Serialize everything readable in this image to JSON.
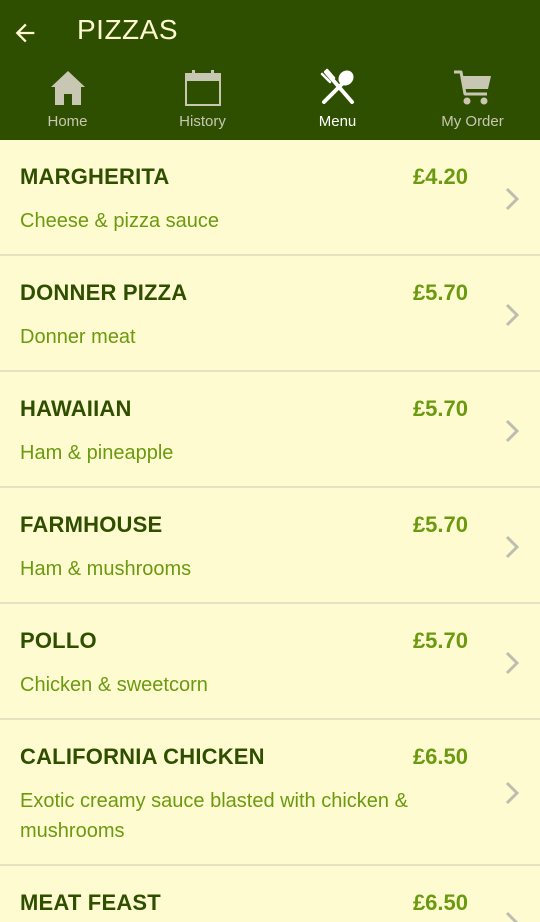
{
  "header": {
    "title": "PIZZAS",
    "back_icon": "arrow-left-icon"
  },
  "nav": {
    "tabs": [
      {
        "label": "Home",
        "icon": "home-icon",
        "active": false
      },
      {
        "label": "History",
        "icon": "calendar-icon",
        "active": false
      },
      {
        "label": "Menu",
        "icon": "fork-spoon-icon",
        "active": true
      },
      {
        "label": "My Order",
        "icon": "cart-icon",
        "active": false
      }
    ]
  },
  "items": [
    {
      "name": "MARGHERITA",
      "price": "£4.20",
      "description": "Cheese & pizza sauce"
    },
    {
      "name": "DONNER PIZZA",
      "price": "£5.70",
      "description": "Donner meat"
    },
    {
      "name": "HAWAIIAN",
      "price": "£5.70",
      "description": "Ham & pineapple"
    },
    {
      "name": "FARMHOUSE",
      "price": "£5.70",
      "description": "Ham & mushrooms"
    },
    {
      "name": "POLLO",
      "price": "£5.70",
      "description": "Chicken & sweetcorn"
    },
    {
      "name": "CALIFORNIA CHICKEN",
      "price": "£6.50",
      "description": "Exotic creamy sauce blasted with chicken & mushrooms"
    },
    {
      "name": "MEAT FEAST",
      "price": "£6.50",
      "description": ""
    }
  ],
  "colors": {
    "header_bg": "#2f4f00",
    "list_bg": "#fffbd0",
    "name": "#2f4f00",
    "accent": "#6a9a10"
  }
}
